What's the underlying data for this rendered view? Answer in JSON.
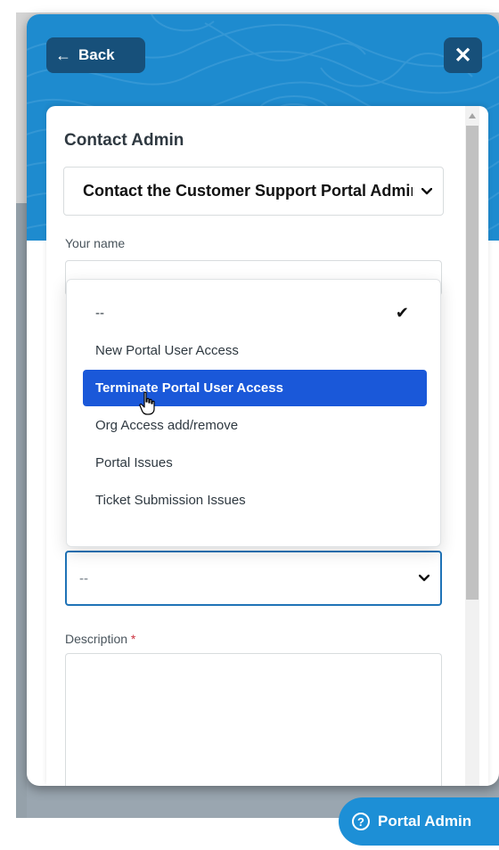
{
  "header": {
    "back_label": "Back",
    "back_icon": "arrow-left-icon",
    "close_icon": "close-icon",
    "accent_color": "#1e8bcf",
    "button_color": "#17507a"
  },
  "form": {
    "title": "Contact Admin",
    "request_type": "Contact the Customer Support Portal Admin",
    "name_label": "Your name",
    "category_value": "--",
    "description_label": "Description",
    "required_marker": "*"
  },
  "dropdown": {
    "options": [
      "--",
      "New Portal User Access",
      "Terminate Portal User Access",
      "Org Access add/remove",
      "Portal Issues",
      "Ticket Submission Issues"
    ],
    "checked_option": "--",
    "highlighted_option": "Terminate Portal User Access",
    "highlight_color": "#1a58d9"
  },
  "launcher": {
    "label": "Portal Admin",
    "icon_glyph": "?",
    "icon": "help-circle-icon"
  }
}
